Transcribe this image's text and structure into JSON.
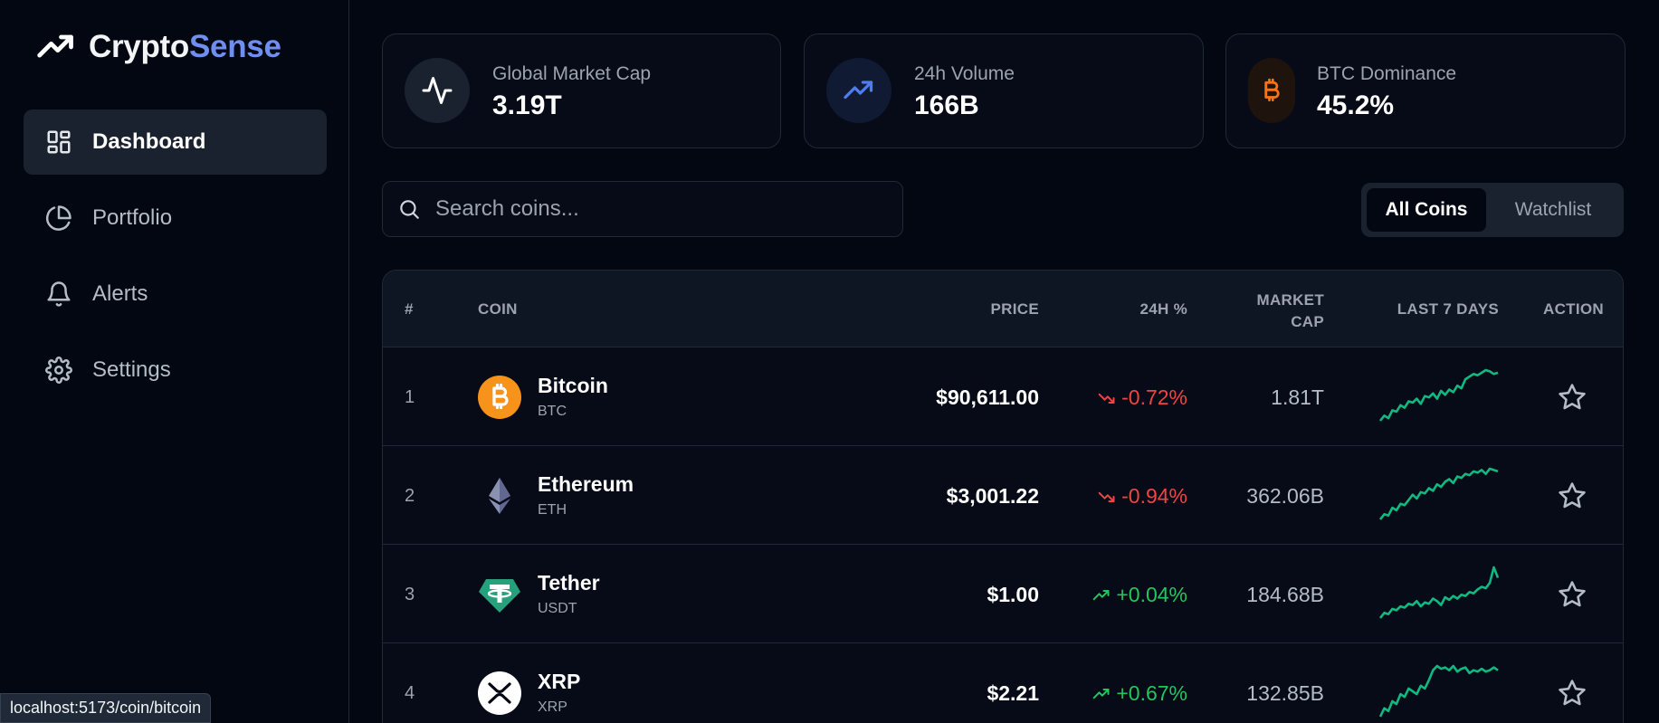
{
  "brand": {
    "name_a": "Crypto",
    "name_b": "Sense",
    "icon": "trending-up-icon"
  },
  "nav": [
    {
      "label": "Dashboard",
      "icon": "dashboard-grid-icon",
      "active": true
    },
    {
      "label": "Portfolio",
      "icon": "pie-chart-icon",
      "active": false
    },
    {
      "label": "Alerts",
      "icon": "bell-icon",
      "active": false
    },
    {
      "label": "Settings",
      "icon": "gear-icon",
      "active": false
    }
  ],
  "stats": [
    {
      "label": "Global Market Cap",
      "value": "3.19T",
      "icon": "activity-icon"
    },
    {
      "label": "24h Volume",
      "value": "166B",
      "icon": "trending-up-icon"
    },
    {
      "label": "BTC Dominance",
      "value": "45.2%",
      "icon": "bitcoin-icon"
    }
  ],
  "search": {
    "placeholder": "Search coins..."
  },
  "tabs": {
    "all": "All Coins",
    "watchlist": "Watchlist",
    "selected": "All Coins"
  },
  "table": {
    "headers": {
      "rank": "#",
      "coin": "COIN",
      "price": "PRICE",
      "change": "24H %",
      "mcap_line1": "MARKET",
      "mcap_line2": "CAP",
      "chart": "LAST 7 DAYS",
      "action": "ACTION"
    },
    "rows": [
      {
        "rank": "1",
        "name": "Bitcoin",
        "symbol": "BTC",
        "price": "$90,611.00",
        "change": "-0.72%",
        "direction": "down",
        "market_cap": "1.81T",
        "spark": [
          10,
          14,
          12,
          18,
          17,
          22,
          20,
          25,
          24,
          27,
          23,
          29,
          28,
          31,
          27,
          33,
          30,
          34,
          32,
          37,
          35,
          42,
          44,
          46,
          45,
          47,
          49,
          48,
          46,
          47
        ]
      },
      {
        "rank": "2",
        "name": "Ethereum",
        "symbol": "ETH",
        "price": "$3,001.22",
        "change": "-0.94%",
        "direction": "down",
        "market_cap": "362.06B",
        "spark": [
          8,
          12,
          11,
          17,
          15,
          20,
          19,
          23,
          27,
          24,
          29,
          28,
          32,
          30,
          35,
          33,
          37,
          39,
          36,
          41,
          40,
          43,
          42,
          45,
          44,
          46,
          43,
          47,
          46,
          45
        ]
      },
      {
        "rank": "3",
        "name": "Tether",
        "symbol": "USDT",
        "price": "$1.00",
        "change": "+0.04%",
        "direction": "up",
        "market_cap": "184.68B",
        "spark": [
          9,
          13,
          12,
          16,
          15,
          18,
          17,
          20,
          19,
          22,
          18,
          21,
          20,
          24,
          22,
          19,
          25,
          23,
          26,
          24,
          27,
          26,
          29,
          28,
          31,
          33,
          32,
          36,
          48,
          40
        ]
      },
      {
        "rank": "4",
        "name": "XRP",
        "symbol": "XRP",
        "price": "$2.21",
        "change": "+0.67%",
        "direction": "up",
        "market_cap": "132.85B",
        "spark": [
          8,
          14,
          12,
          19,
          17,
          24,
          22,
          28,
          26,
          24,
          30,
          28,
          34,
          41,
          44,
          42,
          43,
          41,
          44,
          40,
          42,
          43,
          39,
          41,
          40,
          42,
          40,
          41,
          43,
          41
        ]
      }
    ]
  },
  "status_bar": {
    "url": "localhost:5173/coin/bitcoin"
  },
  "colors": {
    "accent": "#6e8ff0",
    "up": "#22c55e",
    "down": "#ef4444",
    "spark": "#10b981",
    "bitcoin": "#f7931a",
    "tether": "#26a17b"
  }
}
